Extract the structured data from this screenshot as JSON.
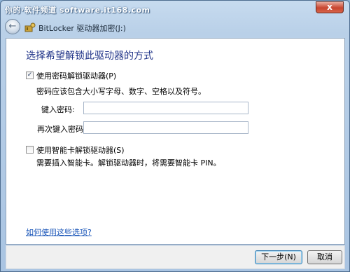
{
  "watermark": "你的·软件频道 software.it168.com",
  "titlebar": {
    "close_label": "x"
  },
  "nav": {
    "back_icon": "back-arrow-icon",
    "app_icon": "bitlocker-key-icon",
    "title": "BitLocker 驱动器加密(J:)"
  },
  "main": {
    "heading": "选择希望解锁此驱动器的方式",
    "password_option": {
      "label": "使用密码解锁驱动器(P)",
      "checked": true,
      "description": "密码应该包含大小写字母、数字、空格以及符号。"
    },
    "fields": [
      {
        "label": "键入密码:",
        "value": ""
      },
      {
        "label": "再次键入密码:",
        "value": ""
      }
    ],
    "smartcard_option": {
      "label": "使用智能卡解锁驱动器(S)",
      "checked": false,
      "description": "需要插入智能卡。解锁驱动器时，将需要智能卡 PIN。"
    },
    "help_link": "如何使用这些选项?"
  },
  "footer": {
    "next_label": "下一步(N)",
    "cancel_label": "取消"
  },
  "colors": {
    "heading": "#1e3287",
    "link": "#1c57b9",
    "close": "#c8452f"
  }
}
